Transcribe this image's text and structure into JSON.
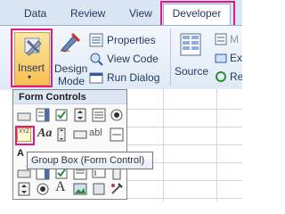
{
  "tabs": {
    "data": "Data",
    "review": "Review",
    "view": "View",
    "developer": "Developer"
  },
  "ribbon": {
    "insert_label": "Insert",
    "design_mode_line1": "Design",
    "design_mode_line2": "Mode",
    "properties_label": "Properties",
    "view_code_label": "View Code",
    "run_dialog_label": "Run Dialog",
    "source_label": "Source",
    "partial_m": "M",
    "partial_exp": "Exp",
    "partial_ref": "Ref"
  },
  "form_controls": {
    "header": "Form Controls",
    "abl_label": "abl",
    "aa_label": "Aa",
    "xyz_label": "XYZ",
    "a_label": "A"
  },
  "tooltip": {
    "text": "Group Box (Form Control)"
  },
  "colors": {
    "highlight": "#e8177f",
    "ribbon_bg": "#dfe9f5",
    "insert_bg": "#f8c04f"
  }
}
